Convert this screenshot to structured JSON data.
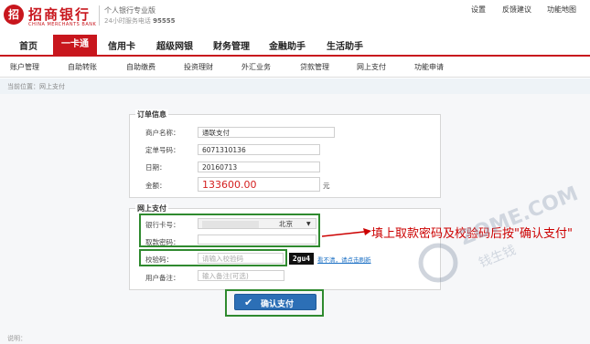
{
  "brand": {
    "logo_char": "招",
    "name_cn": "招商银行",
    "name_en": "CHINA MERCHANTS BANK",
    "edition": "个人银行专业版",
    "hotline_label": "24小时服务电话",
    "hotline_number": "95555"
  },
  "top_links": [
    "设置",
    "反馈建议",
    "功能地图"
  ],
  "main_nav": {
    "items": [
      "首页",
      "一卡通",
      "信用卡",
      "超级网银",
      "财务管理",
      "金融助手",
      "生活助手"
    ],
    "active": "一卡通"
  },
  "sub_nav": [
    "账户管理",
    "自助转账",
    "自助缴费",
    "投资理财",
    "外汇业务",
    "贷款管理",
    "网上支付",
    "功能申请"
  ],
  "breadcrumb": "当前位置：网上支付",
  "order_info": {
    "title": "订单信息",
    "merchant_label": "商户名称：",
    "merchant_value": "通联支付",
    "order_no_label": "定单号码：",
    "order_no_value": "6071310136",
    "date_label": "日期：",
    "date_value": "20160713",
    "amount_label": "金额：",
    "amount_value": "133600.00",
    "amount_unit": "元"
  },
  "payment": {
    "title": "网上支付",
    "card_label": "银行卡号：",
    "card_city": "北京",
    "pin_label": "取款密码：",
    "captcha_label": "校验码：",
    "captcha_placeholder": "请输入校验码",
    "captcha_image_text": "2gu4",
    "captcha_refresh": "看不清，请点击刷新",
    "remark_label": "用户备注：",
    "remark_placeholder": "输入备注(可选)",
    "confirm_label": "确认支付"
  },
  "annotation": {
    "text": "填上取款密码及校验码后按\"确认支付\"",
    "color": "#cc0000"
  },
  "watermark": {
    "text": "ZOME.COM",
    "subtext": "钱生钱"
  },
  "footer_note": "说明：",
  "colors": {
    "brand_red": "#c8161d",
    "highlight_green": "#2f8a2f",
    "button_blue": "#2c6fb6",
    "amount_red": "#d42020"
  }
}
